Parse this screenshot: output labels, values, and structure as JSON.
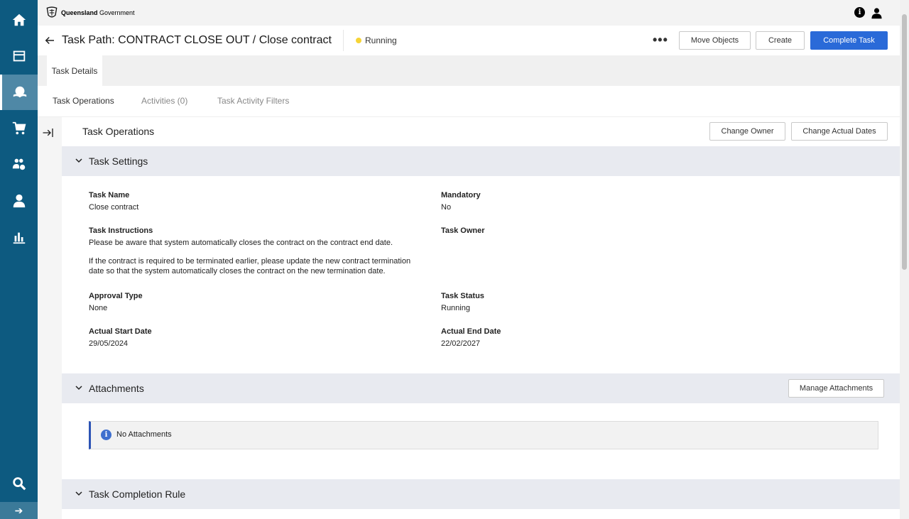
{
  "app": {
    "logo_text_bold": "Queensland",
    "logo_text_regular": "Government"
  },
  "header": {
    "title": "Task Path: CONTRACT CLOSE OUT / Close contract",
    "status": "Running",
    "status_color": "#f6d437",
    "more_label": "•••",
    "buttons": {
      "move_objects": "Move Objects",
      "create": "Create",
      "complete_task": "Complete Task"
    }
  },
  "detail_tab": "Task Details",
  "subtabs": [
    "Task Operations",
    "Activities (0)",
    "Task Activity Filters"
  ],
  "operations": {
    "title": "Task Operations",
    "change_owner": "Change Owner",
    "change_actual_dates": "Change Actual Dates"
  },
  "task_settings": {
    "title": "Task Settings",
    "task_name_label": "Task Name",
    "task_name": "Close contract",
    "mandatory_label": "Mandatory",
    "mandatory": "No",
    "instructions_label": "Task Instructions",
    "instructions_line1": "Please be aware that system automatically closes the contract on the contract end date.",
    "instructions_line2": "If the contract is required to be terminated earlier, please update the new contract termination date so that the system automatically closes the contract on the new termination date.",
    "task_owner_label": "Task Owner",
    "approval_type_label": "Approval Type",
    "approval_type": "None",
    "task_status_label": "Task Status",
    "task_status": "Running",
    "start_date_label": "Actual Start Date",
    "start_date": "29/05/2024",
    "end_date_label": "Actual End Date",
    "end_date": "22/02/2027"
  },
  "attachments": {
    "title": "Attachments",
    "manage_button": "Manage Attachments",
    "empty_text": "No Attachments"
  },
  "completion_rule": {
    "title": "Task Completion Rule"
  },
  "colors": {
    "nav_bg": "#0d5a80",
    "primary": "#2a6ad8",
    "section_bg": "#e8eaf0"
  }
}
